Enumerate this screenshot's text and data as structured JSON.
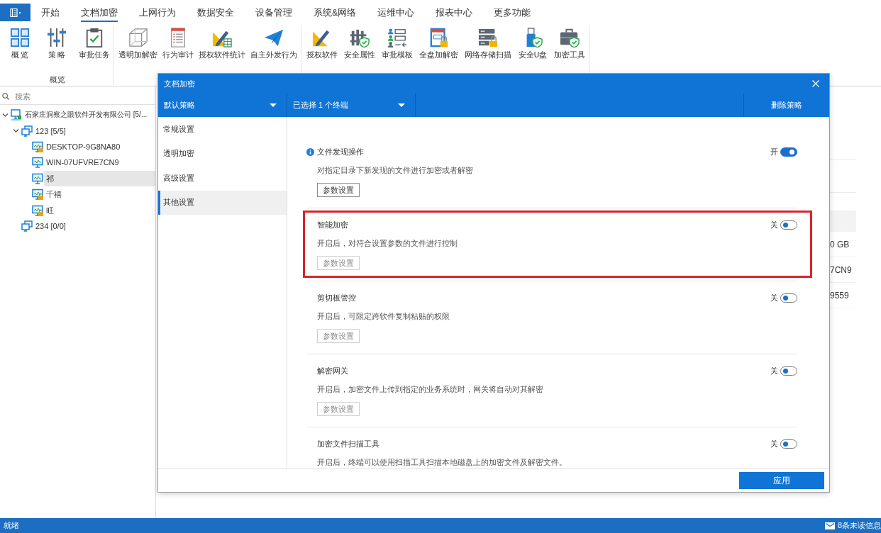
{
  "menu_tabs": [
    {
      "label": "开始",
      "selected": false
    },
    {
      "label": "文档加密",
      "selected": true
    },
    {
      "label": "上网行为",
      "selected": false
    },
    {
      "label": "数据安全",
      "selected": false
    },
    {
      "label": "设备管理",
      "selected": false
    },
    {
      "label": "系统&网络",
      "selected": false
    },
    {
      "label": "运维中心",
      "selected": false
    },
    {
      "label": "报表中心",
      "selected": false
    },
    {
      "label": "更多功能",
      "selected": false
    }
  ],
  "ribbon": {
    "groups": [
      {
        "label": "概览",
        "items": [
          {
            "label": "概 览"
          },
          {
            "label": "策 略"
          },
          {
            "label": "审批任务"
          }
        ]
      },
      {
        "items": [
          {
            "label": "透明加解密"
          },
          {
            "label": "行为审计"
          },
          {
            "label": "授权软件统计"
          },
          {
            "label": "自主外发行为"
          }
        ]
      },
      {
        "items": [
          {
            "label": "授权软件"
          },
          {
            "label": "安全属性"
          },
          {
            "label": "审批模板"
          },
          {
            "label": "全盘加解密"
          },
          {
            "label": "网络存储扫描"
          },
          {
            "label": "安全U盘"
          },
          {
            "label": "加密工具"
          }
        ]
      }
    ]
  },
  "left_panel": {
    "search": {
      "placeholder": "搜索"
    },
    "tree": [
      {
        "kind": "organization",
        "label": "石家庄洞察之眼软件开发有限公司",
        "count": "[5/...",
        "expanded": true,
        "selected": false,
        "children": [
          {
            "kind": "group",
            "label": "123",
            "count": "[5/5]",
            "expanded": true,
            "selected": false,
            "children": [
              {
                "kind": "computer",
                "label": "DESKTOP-9G8NA80",
                "locked": true,
                "selected": false
              },
              {
                "kind": "computer",
                "label": "WIN-07UFVRE7CN9",
                "locked": false,
                "selected": false
              },
              {
                "kind": "computer",
                "label": "祁",
                "locked": false,
                "selected": true
              },
              {
                "kind": "computer",
                "label": "千禧",
                "locked": true,
                "selected": false
              },
              {
                "kind": "computer",
                "label": "旺",
                "locked": true,
                "selected": false
              }
            ]
          },
          {
            "kind": "group",
            "label": "234",
            "count": "[0/0]",
            "expanded": false,
            "selected": false
          }
        ]
      }
    ]
  },
  "background_table": {
    "rows": [
      "0 GB",
      "7CN9",
      "9559"
    ]
  },
  "dialog": {
    "title": "文档加密",
    "toolbar": {
      "dropdowns": [
        {
          "value": "默认策略"
        },
        {
          "value": "已选择 1 个终端"
        }
      ],
      "delete_button": "删除策略"
    },
    "nav": [
      {
        "label": "常规设置",
        "selected": false
      },
      {
        "label": "透明加密",
        "selected": false
      },
      {
        "label": "高级设置",
        "selected": false
      },
      {
        "label": "其他设置",
        "selected": true
      }
    ],
    "sections": [
      {
        "title": "文件发现操作",
        "info_icon": true,
        "on": true,
        "switch_label": "开",
        "highlighted": false,
        "description": "对指定目录下新发现的文件进行加密或者解密",
        "button": {
          "label": "参数设置",
          "disabled": false
        }
      },
      {
        "title": "智能加密",
        "info_icon": false,
        "on": false,
        "switch_label": "关",
        "highlighted": true,
        "description": "开启后，对符合设置参数的文件进行控制",
        "button": {
          "label": "参数设置",
          "disabled": true
        }
      },
      {
        "title": "剪切板管控",
        "info_icon": false,
        "on": false,
        "switch_label": "关",
        "highlighted": false,
        "description": "开启后，可限定跨软件复制粘贴的权限",
        "button": {
          "label": "参数设置",
          "disabled": true
        }
      },
      {
        "title": "解密网关",
        "info_icon": false,
        "on": false,
        "switch_label": "关",
        "highlighted": false,
        "description": "开启后，加密文件上传到指定的业务系统时，网关将自动对其解密",
        "button": {
          "label": "参数设置",
          "disabled": true
        }
      },
      {
        "title": "加密文件扫描工具",
        "info_icon": false,
        "on": false,
        "switch_label": "关",
        "highlighted": false,
        "description": "开启后，终端可以使用扫描工具扫描本地磁盘上的加密文件及解密文件。"
      }
    ],
    "apply_button": "应用"
  },
  "status_bar": {
    "text": "就绪",
    "messages": "8条未读信息"
  }
}
